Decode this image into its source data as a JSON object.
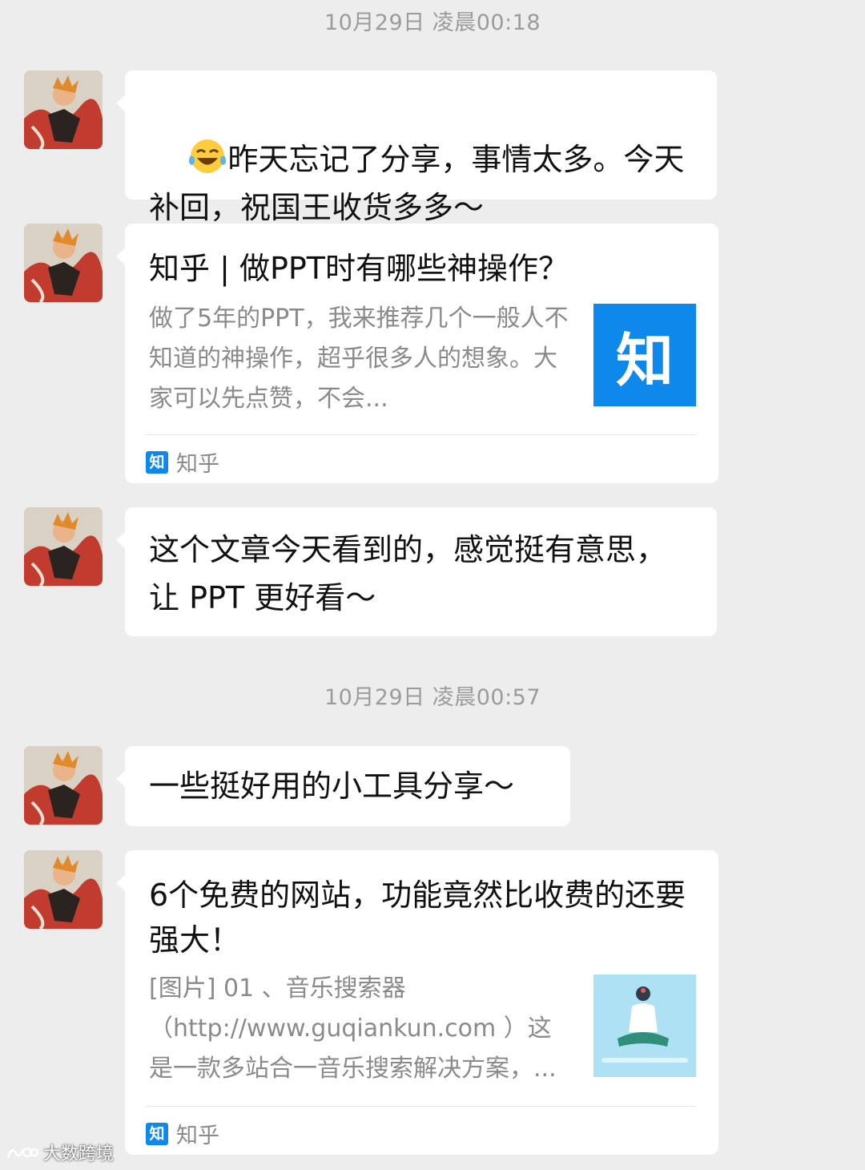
{
  "timestamps": [
    "10月29日 凌晨00:18",
    "10月29日 凌晨00:57"
  ],
  "messages": {
    "m1": {
      "text": "昨天忘记了分享，事情太多。今天补回，祝国王收货多多～",
      "emoji": "tears-of-joy-emoji"
    },
    "m2": {
      "title": "知乎 | 做PPT时有哪些神操作？",
      "description": "做了5年的PPT，我来推荐几个一般人不知道的神操作，超乎很多人的想象。大家可以先点赞，不会...",
      "thumb_text": "知",
      "source": "知乎",
      "source_icon_text": "知"
    },
    "m3": {
      "text": "这个文章今天看到的，感觉挺有意思，让 PPT 更好看～"
    },
    "m4": {
      "text": "一些挺好用的小工具分享～"
    },
    "m5": {
      "title": "6个免费的网站，功能竟然比收费的还要强大！",
      "description": "[图片] 01 、音乐搜索器（http://www.guqiankun.com ）这是一款多站合一音乐搜索解决方案，...",
      "source": "知乎",
      "source_icon_text": "知"
    }
  },
  "watermark": "大数跨境",
  "colors": {
    "background": "#ededed",
    "bubble": "#ffffff",
    "zhihu_blue": "#0f88eb",
    "timestamp": "#9b9b9b"
  }
}
